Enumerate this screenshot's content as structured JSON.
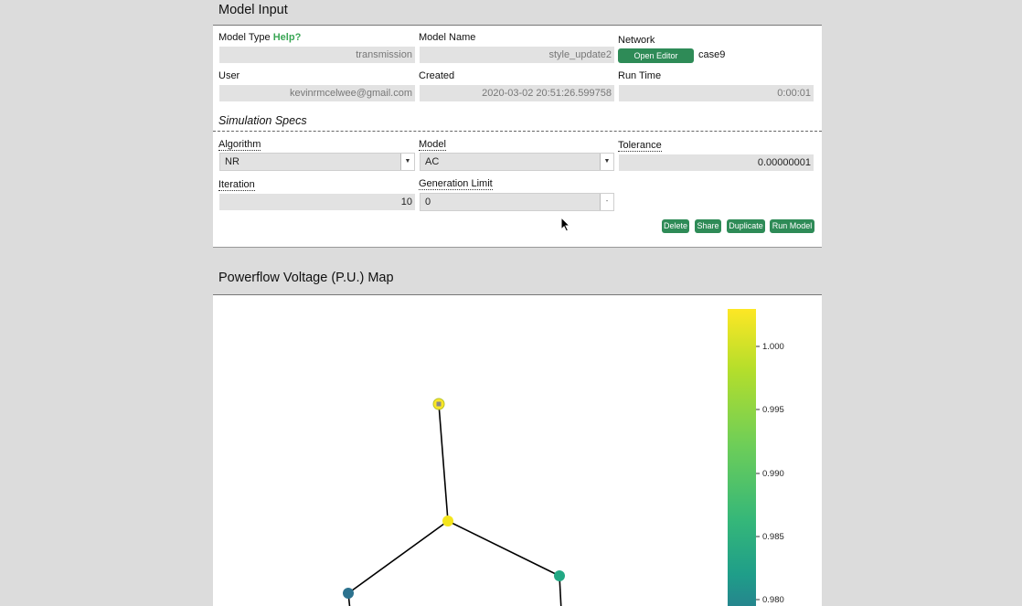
{
  "model_input": {
    "section_title": "Model Input",
    "model_type_label": "Model Type",
    "help_link": "Help?",
    "model_type_value": "transmission",
    "model_name_label": "Model Name",
    "model_name_value": "style_update2",
    "network_label": "Network",
    "open_editor_label": "Open Editor",
    "network_value": "case9",
    "user_label": "User",
    "user_value": "kevinrmcelwee@gmail.com",
    "created_label": "Created",
    "created_value": "2020-03-02 20:51:26.599758",
    "run_time_label": "Run Time",
    "run_time_value": "0:00:01"
  },
  "simulation_specs": {
    "title": "Simulation Specs",
    "algorithm_label": "Algorithm",
    "algorithm_value": "NR",
    "model_label": "Model",
    "model_value": "AC",
    "tolerance_label": "Tolerance",
    "tolerance_value": "0.00000001",
    "iteration_label": "Iteration",
    "iteration_value": "10",
    "generation_limit_label": "Generation Limit",
    "generation_limit_value": "0"
  },
  "actions": {
    "delete": "Delete",
    "share": "Share",
    "duplicate": "Duplicate",
    "run_model": "Run Model"
  },
  "map": {
    "section_title": "Powerflow Voltage (P.U.) Map",
    "colorbar_ticks": [
      "1.000",
      "0.995",
      "0.990",
      "0.985",
      "0.980"
    ],
    "colormap": [
      "#fde725",
      "#b5de2b",
      "#6ece58",
      "#35b779",
      "#1f9e89",
      "#26828e"
    ],
    "edge_color": "#000000"
  },
  "icons": {
    "dropdown": "chevron-down-icon",
    "cursor": "mouse-cursor-icon"
  }
}
